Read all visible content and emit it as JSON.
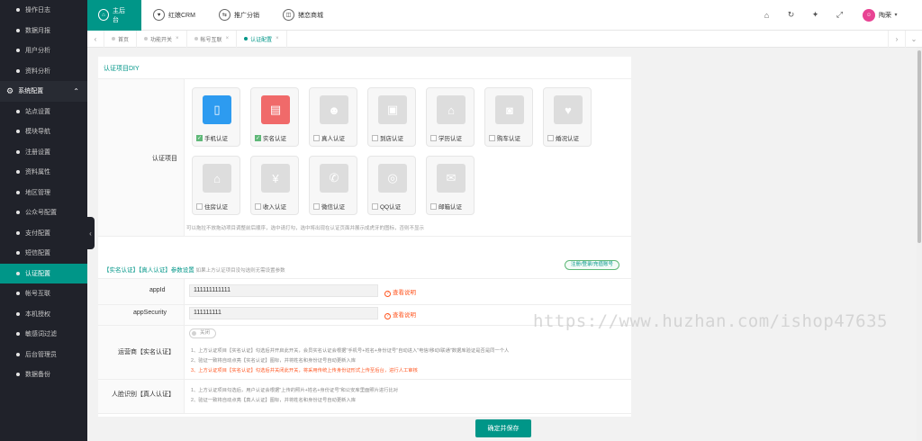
{
  "sidebar": {
    "items_top": [
      "操作日志",
      "数据月报",
      "用户分析",
      "资料分析"
    ],
    "group": "系统配置",
    "items": [
      "站点设置",
      "模块导航",
      "注册设置",
      "资料属性",
      "地区管理",
      "公众号配置",
      "支付配置",
      "短信配置",
      "认证配置",
      "帐号互联",
      "本机授权",
      "敏感词过滤",
      "后台管理员",
      "数据备份"
    ],
    "active_index": 8
  },
  "topnav": {
    "items": [
      "主后台",
      "红娘CRM",
      "推广分销",
      "猪恋商城"
    ],
    "user": "陶荣"
  },
  "tabs": {
    "items": [
      "首页",
      "功能开关",
      "帐号互联",
      "认证配置"
    ],
    "active_index": 3
  },
  "cert": {
    "section_title": "认证项目DIY",
    "row_label": "认证项目",
    "items": [
      {
        "label": "手机认证",
        "checked": true,
        "icon": "phone-icon"
      },
      {
        "label": "实名认证",
        "checked": true,
        "icon": "id-card-icon"
      },
      {
        "label": "真人认证",
        "checked": false,
        "icon": "person-icon"
      },
      {
        "label": "到店认证",
        "checked": false,
        "icon": "shop-icon"
      },
      {
        "label": "学历认证",
        "checked": false,
        "icon": "graduation-cap-icon"
      },
      {
        "label": "购车认证",
        "checked": false,
        "icon": "car-icon"
      },
      {
        "label": "婚况认证",
        "checked": false,
        "icon": "heart-icon"
      },
      {
        "label": "住房认证",
        "checked": false,
        "icon": "house-icon"
      },
      {
        "label": "收入认证",
        "checked": false,
        "icon": "yen-coin-icon"
      },
      {
        "label": "微信认证",
        "checked": false,
        "icon": "wechat-icon"
      },
      {
        "label": "QQ认证",
        "checked": false,
        "icon": "qq-icon"
      },
      {
        "label": "邮箱认证",
        "checked": false,
        "icon": "mail-icon"
      }
    ],
    "hint": "可以拖拉不放拖动项目调整前后顺序，选中请打勾，选中将出现在认证页面并展示成虎牙的图标，否则不显示"
  },
  "params": {
    "title_em": "【实名认证】【真人认证】参数设置",
    "title_sub": "如果上方认证项目没勾选则无需设置参数",
    "badge": "注册/登录/充值账号",
    "appid_label": "appId",
    "appid_value": "111111111111",
    "appsecurity_label": "appSecurity",
    "appsecurity_value": "111111111",
    "help_text": "查看说明",
    "operator_label": "运营商【实名认证】",
    "switch_text": "关闭",
    "operator_notes": [
      "1、上方认证项目【实名认证】勾选后并开启此开关，会员实名认证会根据\"手机号+姓名+身份证号\"自动进入\"电信/移动/联通\"数据库验证是否是同一个人",
      "2、验证一致将自动点亮【实名认证】图标，并将姓名和身份证号自动更新入库",
      "3、上方认证项目【实名认证】勾选后并关闭此开关，将采用传统上传身份证形式上传至后台，进行人工审核"
    ],
    "face_label": "人脸识别【真人认证】",
    "face_notes": [
      "1、上方认证项目勾选后，用户认证会根据\"上传的照片+姓名+身份证号\"和公安库里面照片进行比对",
      "2、验证一致将自动点亮【真人认证】图标，并将姓名和身份证号自动更新入库"
    ]
  },
  "save_label": "确定并保存",
  "watermark": "https://www.huzhan.com/ishop47635"
}
